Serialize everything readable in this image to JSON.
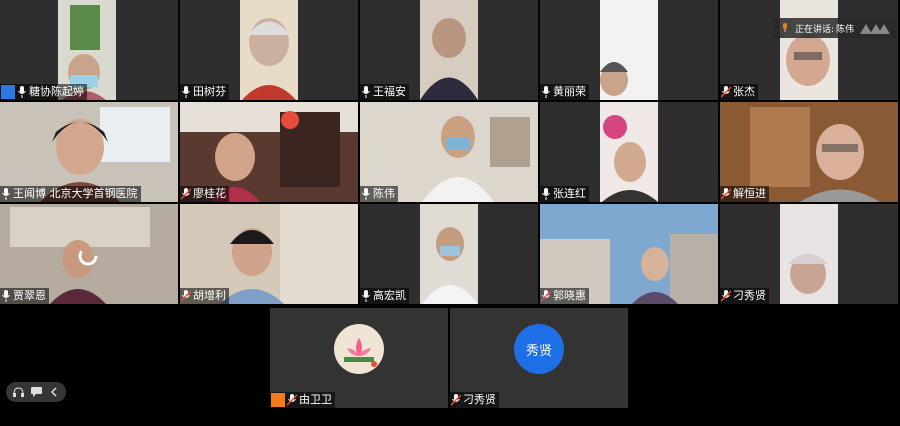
{
  "speaking": {
    "prefix": "正在讲话:",
    "name": "陈伟"
  },
  "participants": [
    {
      "name": "糖协陈起婷",
      "host": true
    },
    {
      "name": "田树芬"
    },
    {
      "name": "王福安"
    },
    {
      "name": "黄丽荣"
    },
    {
      "name": "张杰"
    },
    {
      "name": "王闻博  北京大学首钢医院"
    },
    {
      "name": "廖桂花"
    },
    {
      "name": "陈伟",
      "active": true
    },
    {
      "name": "张连红"
    },
    {
      "name": "解恒进"
    },
    {
      "name": "贾翠恩"
    },
    {
      "name": "胡增利"
    },
    {
      "name": "高宏凯"
    },
    {
      "name": "郭晓惠"
    },
    {
      "name": "刁秀贤"
    }
  ],
  "bottom": [
    {
      "name": "由卫卫",
      "host": true
    },
    {
      "name": "刁秀贤",
      "avatar_text": "秀贤"
    }
  ],
  "colors": {
    "active_border": "#3cb371",
    "avatar_blue": "#1e6fe6",
    "host_orange": "#f07d1a",
    "host_blue": "#2a7ae2"
  }
}
